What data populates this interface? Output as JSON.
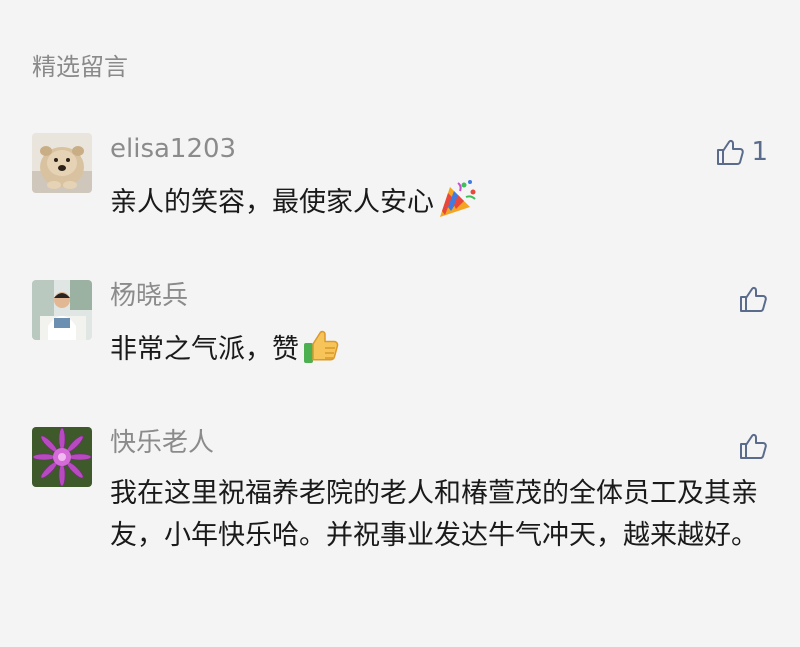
{
  "section": {
    "title": "精选留言"
  },
  "comments": [
    {
      "name": "elisa1203",
      "text": "亲人的笑容，最使家人安心",
      "emoji": "party-popper-icon",
      "likes": "1",
      "avatar": "chow-chow-dog-avatar"
    },
    {
      "name": "杨晓兵",
      "text": "非常之气派，赞",
      "emoji": "thumbs-up-emoji-icon",
      "likes": "",
      "avatar": "person-reading-avatar"
    },
    {
      "name": "快乐老人",
      "text": "我在这里祝福养老院的老人和椿萱茂的全体员工及其亲友，小年快乐哈。并祝事业发达牛气冲天，越来越好。",
      "emoji": "",
      "likes": "",
      "avatar": "purple-chrysanthemum-avatar"
    }
  ],
  "colors": {
    "background": "#f4f4f4",
    "name_text": "#8b8b8b",
    "body_text": "#1a1a1a",
    "like_icon": "#5a6b8c"
  }
}
